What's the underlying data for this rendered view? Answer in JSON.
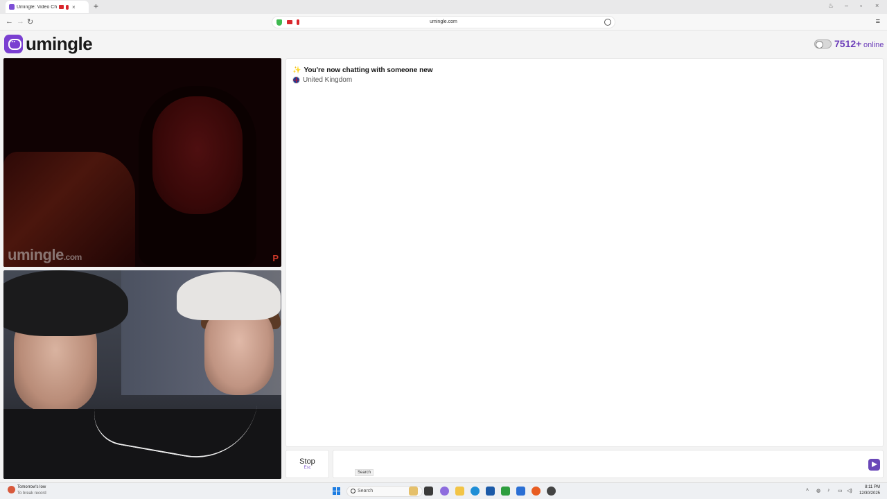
{
  "browser": {
    "tab_title": "Umingle: Video Ch",
    "tab_close": "×",
    "new_tab": "+",
    "url": "umingle.com",
    "back": "←",
    "forward": "→",
    "reload": "↻",
    "menu": "≡"
  },
  "header": {
    "logo_text": "umingle",
    "online_count": "7512+",
    "online_label": "online",
    "brand_color": "#7a3fd1"
  },
  "video": {
    "watermark_main": "umingle",
    "watermark_tld": ".com",
    "report_glyph": "P"
  },
  "chat": {
    "system_message": "You're now chatting with someone new",
    "country": "United Kingdom",
    "sparkle_icon": "✨"
  },
  "controls": {
    "stop_label": "Stop",
    "stop_hotkey": "Esc",
    "message_placeholder": "",
    "tooltip": "Search"
  },
  "taskbar": {
    "weather_line1": "Tomorrow's low",
    "weather_line2": "To break record",
    "search_text": "Search",
    "time": "8:11 PM",
    "date": "12/30/2025"
  }
}
